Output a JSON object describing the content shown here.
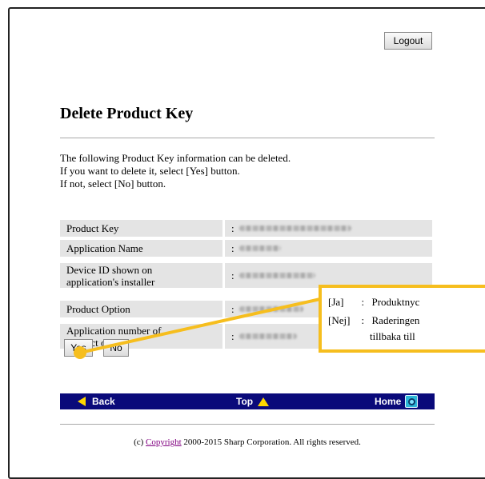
{
  "header": {
    "logout_label": "Logout"
  },
  "page": {
    "title": "Delete Product Key",
    "intro": [
      "The following Product Key information can be deleted.",
      "If you want to delete it, select [Yes] button.",
      "If not, select [No] button."
    ]
  },
  "table": {
    "rows": [
      {
        "label": "Product Key",
        "value": ":"
      },
      {
        "label": "Application Name",
        "value": ":"
      },
      {
        "label_lines": [
          "Device ID shown on",
          "application's installer"
        ],
        "value": ":"
      },
      {
        "label": "Product Option",
        "value": ":"
      },
      {
        "label_lines": [
          "Application number of",
          "product option"
        ],
        "value": ":"
      }
    ]
  },
  "buttons": {
    "yes_label": "Yes",
    "no_label": "No"
  },
  "navbar": {
    "back_label": "Back",
    "top_label": "Top",
    "home_label": "Home",
    "bar_color": "#0a0a7a",
    "arrow_color": "#ffd800"
  },
  "footer": {
    "prefix": "(c) ",
    "link_label": "Copyright",
    "suffix": " 2000-2015 Sharp Corporation. All rights reserved."
  },
  "callout": {
    "border_color": "#f6be1e",
    "lines": [
      {
        "key": "[Ja]",
        "sep": ":",
        "text": "Produktnyc"
      },
      {
        "key": "[Nej]",
        "sep": ":",
        "text": "Raderingen"
      },
      {
        "key": "",
        "sep": "",
        "text": "tillbaka till"
      }
    ]
  }
}
